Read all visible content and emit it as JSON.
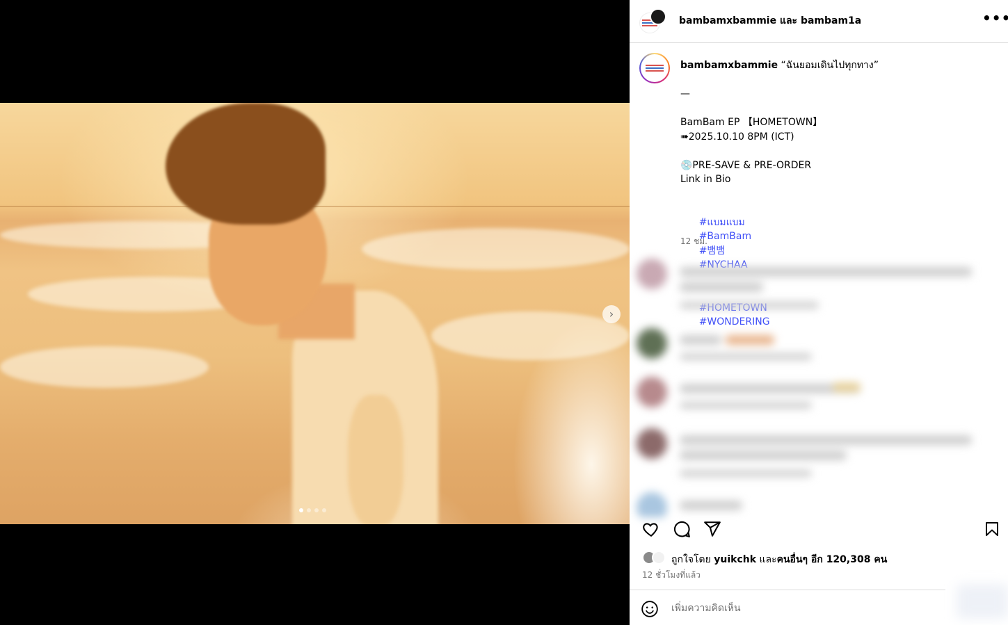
{
  "post": {
    "header_names": "bambamxbammie และ bambam1a",
    "more_label": "•••",
    "next_label": "›",
    "carousel": {
      "total": 4,
      "current": 1
    }
  },
  "caption": {
    "username": "bambamxbammie",
    "quote": " “ฉันยอมเดินไปทุกทาง”",
    "dash": "—",
    "line_ep": "BamBam EP 【HOMETOWN】",
    "line_date": "➠2025.10.10 8PM (ICT)",
    "line_presave": "💿PRE-SAVE & PRE-ORDER",
    "line_link": "Link in Bio",
    "tags_line1": [
      "#แบมแบม",
      "#BamBam",
      "#뱀뱀",
      "#NYCHAA"
    ],
    "tags_line2": [
      "#HOMETOWN",
      "#WONDERING"
    ],
    "time": "12 ชม."
  },
  "likes": {
    "prefix": "ถูกใจโดย ",
    "user": "yuikchk",
    "middle": " และ",
    "others": "คนอื่นๆ อีก 120,308 คน"
  },
  "post_time": "12 ชั่วโมงที่แล้ว",
  "comment_input": {
    "placeholder": "เพิ่มความคิดเห็น"
  },
  "icons": [
    "heart-icon",
    "comment-icon",
    "share-icon",
    "bookmark-icon",
    "emoji-icon",
    "more-icon",
    "chevron-right-icon"
  ],
  "colors": {
    "hashtag": "#4150f7",
    "muted": "#737373",
    "border": "#dbdbdb"
  }
}
